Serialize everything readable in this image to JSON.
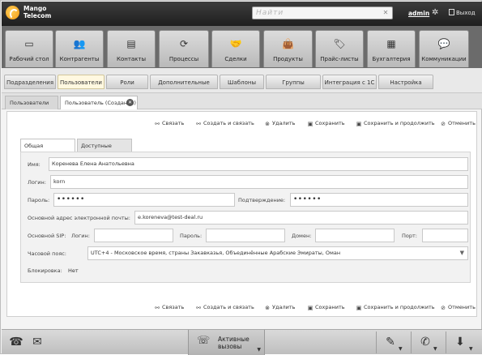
{
  "brand": {
    "line1": "Mango",
    "line2": "Telecom"
  },
  "topbar": {
    "search_placeholder": "Найти",
    "user": "admin",
    "exit_label": "Выход"
  },
  "modules": [
    {
      "label": "Рабочий стол",
      "icon": "monitor-icon"
    },
    {
      "label": "Контрагенты",
      "icon": "people-icon"
    },
    {
      "label": "Контакты",
      "icon": "contact-card-icon"
    },
    {
      "label": "Процессы",
      "icon": "process-cycle-icon"
    },
    {
      "label": "Сделки",
      "icon": "handshake-icon"
    },
    {
      "label": "Продукты",
      "icon": "shopping-bag-icon"
    },
    {
      "label": "Прайс-листы",
      "icon": "price-tag-icon"
    },
    {
      "label": "Бухгалтерия",
      "icon": "calculator-icon"
    },
    {
      "label": "Коммуникации",
      "icon": "chat-bubble-icon"
    }
  ],
  "subtabs": [
    {
      "label": "Подразделения"
    },
    {
      "label": "Пользователи"
    },
    {
      "label": "Роли"
    },
    {
      "label": "Дополнительные поля"
    },
    {
      "label": "Шаблоны"
    },
    {
      "label": "Группы продуктов"
    },
    {
      "label": "Интеграция с 1С"
    },
    {
      "label": "Настройка счетов"
    }
  ],
  "doctabs": [
    {
      "label": "Пользователи"
    },
    {
      "label": "Пользователь (Создание)"
    }
  ],
  "toolbar": {
    "link": "Связать",
    "create_link": "Создать и связать",
    "delete": "Удалить",
    "save": "Сохранить",
    "save_continue": "Сохранить и продолжить",
    "cancel": "Отменить"
  },
  "inner_tabs": [
    {
      "label": "Общая информация"
    },
    {
      "label": "Доступные команды"
    }
  ],
  "form": {
    "name_label": "Имя:",
    "name_value": "Коренева Елена Анатольевна",
    "login_label": "Логин:",
    "login_value": "korn",
    "password_label": "Пароль:",
    "password_value": "••••••",
    "confirm_label": "Подтверждение:",
    "confirm_value": "••••••",
    "email_label": "Основной адрес электронной почты:",
    "email_value": "e.koreneva@test-deal.ru",
    "sip_label": "Основной SIP:",
    "sip_login_label": "Логин:",
    "sip_login_value": "",
    "sip_password_label": "Пароль:",
    "sip_password_value": "",
    "sip_domain_label": "Домен:",
    "sip_domain_value": "",
    "sip_port_label": "Порт:",
    "sip_port_value": "",
    "timezone_label": "Часовой пояс:",
    "timezone_value": "UTC+4 - Московское время, страны Закавказья, Объединённые Арабские Эмираты, Оман",
    "blocked_label": "Блокировка:",
    "blocked_value": "Нет"
  },
  "bottombar": {
    "active_calls_line1": "Активные",
    "active_calls_line2": "вызовы"
  }
}
